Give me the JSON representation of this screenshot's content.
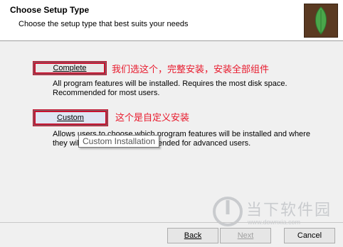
{
  "header": {
    "title": "Choose Setup Type",
    "subtitle": "Choose the setup type that best suits your needs"
  },
  "options": {
    "complete": {
      "label": "Complete",
      "annotation": "我们选这个，完整安装，安装全部组件",
      "description_line1": "All program features will be installed. Requires the most disk space.",
      "description_line2": "Recommended for most users."
    },
    "custom": {
      "label": "Custom",
      "annotation": "这个是自定义安装",
      "description_line1": "Allows users to choose which program features will be installed and where",
      "description_line2": "they will be installed. Recommended for advanced users.",
      "tooltip": "Custom Installation"
    }
  },
  "footer": {
    "back_label": "Back",
    "next_label": "Next",
    "cancel_label": "Cancel"
  },
  "watermark": {
    "text": "当下软件园",
    "url": "www.downxia.com"
  },
  "colors": {
    "annotation_red": "#e8192c",
    "logo_bg": "#5a3a22",
    "leaf_green": "#4aa64a"
  }
}
